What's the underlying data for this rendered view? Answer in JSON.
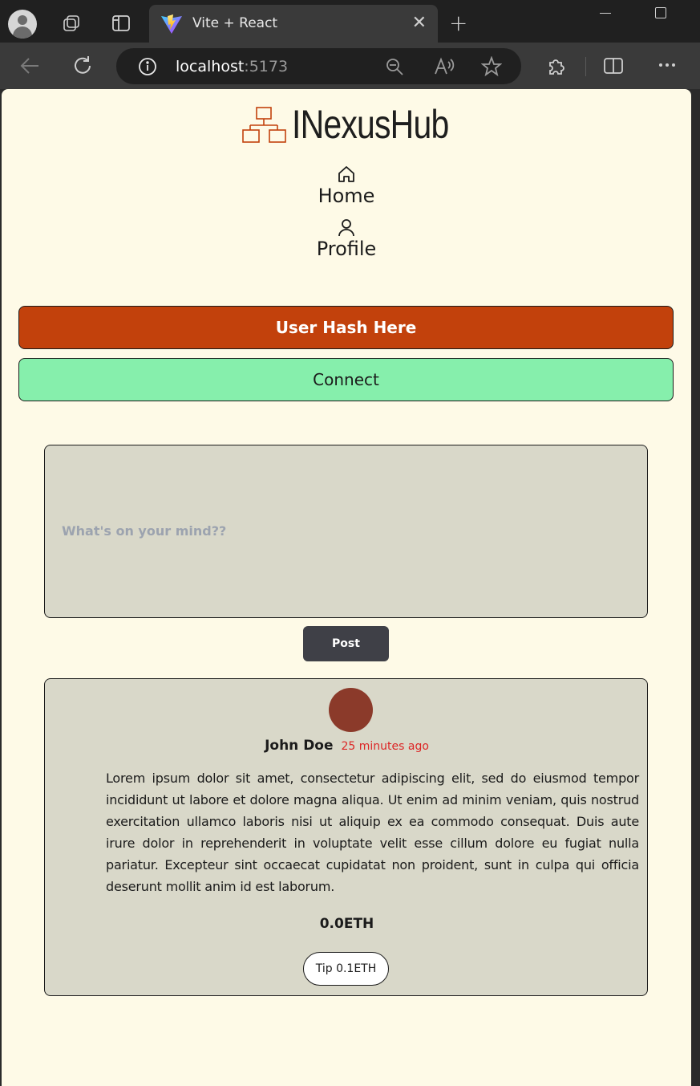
{
  "browser": {
    "tab_title": "Vite + React",
    "url_host": "localhost",
    "url_port": ":5173"
  },
  "brand": {
    "name": "INexusHub",
    "logo_icon": "sitemap-icon",
    "accent_color": "#c2410c"
  },
  "nav": {
    "items": [
      {
        "label": "Home",
        "icon": "home-icon"
      },
      {
        "label": "Profile",
        "icon": "user-icon"
      }
    ]
  },
  "actions": {
    "user_hash_label": "User Hash Here",
    "connect_label": "Connect"
  },
  "composer": {
    "placeholder": "What's on your mind??",
    "value": "",
    "post_label": "Post"
  },
  "posts": [
    {
      "author": "John Doe",
      "time": "25 minutes ago",
      "body": "Lorem ipsum dolor sit amet, consectetur adipiscing elit, sed do eiusmod tempor incididunt ut labore et dolore magna aliqua. Ut enim ad minim veniam, quis nostrud exercitation ullamco laboris nisi ut aliquip ex ea commodo consequat. Duis aute irure dolor in reprehenderit in voluptate velit esse cillum dolore eu fugiat nulla pariatur. Excepteur sint occaecat cupidatat non proident, sunt in culpa qui officia deserunt mollit anim id est laborum.",
      "amount": "0.0ETH",
      "tip_label": "Tip 0.1ETH"
    }
  ]
}
